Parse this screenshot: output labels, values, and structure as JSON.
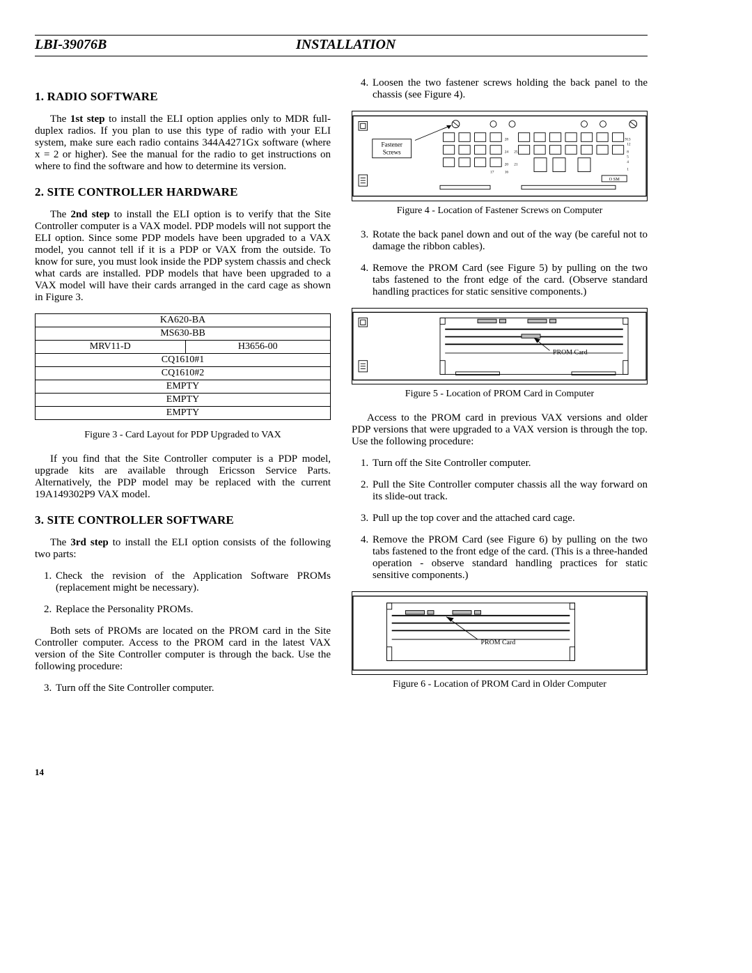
{
  "header": {
    "doc_id": "LBI-39076B",
    "title": "INSTALLATION"
  },
  "left": {
    "h1": "1. RADIO SOFTWARE",
    "p1a": "The ",
    "p1b": "1st step",
    "p1c": " to install the ELI option applies only to MDR full-duplex radios.  If you plan to use this type of radio with your ELI system, make sure each radio contains 344A4271Gx software (where x = 2 or higher).  See the manual for the radio to get instructions on where to find the software and how to determine its version.",
    "h2": "2. SITE CONTROLLER HARDWARE",
    "p2a": "The ",
    "p2b": "2nd step",
    "p2c": " to install the ELI option is to verify that the Site Controller computer is a VAX model.  PDP models will not support the ELI option.  Since some PDP models have been upgraded to a VAX model, you cannot tell if it is a PDP or VAX from the outside.  To know for sure, you must look inside the PDP system chassis and check what cards are installed. PDP models that have been upgraded to a VAX model will have their cards arranged in the card cage as shown in Figure 3.",
    "table": {
      "r1": "KA620-BA",
      "r2": "MS630-BB",
      "r3a": "MRV11-D",
      "r3b": "H3656-00",
      "r4": "CQ1610#1",
      "r5": "CQ1610#2",
      "r6": "EMPTY",
      "r7": "EMPTY",
      "r8": "EMPTY"
    },
    "fig3cap": "Figure 3 - Card Layout for PDP Upgraded to VAX",
    "p3": "If you find that the Site Controller computer is a PDP model, upgrade kits are available through Ericsson Service Parts.  Alternatively, the PDP model may be replaced with the current 19A149302P9 VAX model.",
    "h3": "3. SITE CONTROLLER SOFTWARE",
    "p4a": "The ",
    "p4b": "3rd step",
    "p4c": " to install the ELI option consists of the following two parts:",
    "li1": "Check the revision of the Application Software PROMs (replacement might be necessary).",
    "li2": "Replace the Personality PROMs.",
    "p5": "Both sets of PROMs are located on the PROM card in the Site Controller computer.  Access to the PROM card in the latest VAX version of the Site Controller computer is through the back. Use the following procedure:",
    "li3": "Turn off the Site Controller computer."
  },
  "right": {
    "li4": "Loosen the two fastener screws holding the back panel to the chassis (see Figure 4).",
    "fig4": {
      "label1": "Fastener",
      "label2": "Screws",
      "nums": {
        "n28": "28",
        "n25": "25",
        "n24": "24",
        "n21": "21",
        "n20": "20",
        "n17": "17",
        "n16": "16",
        "n13": "13",
        "n12": "12",
        "n9": "9",
        "n8": "8",
        "n5": "5",
        "n4": "4",
        "n1": "1"
      },
      "osm": "O SM"
    },
    "fig4cap": "Figure 4 - Location of Fastener Screws on Computer",
    "li5": "Rotate the back panel down and out of the way (be careful not to damage the ribbon cables).",
    "li6": "Remove the PROM Card (see Figure 5) by pulling on the two tabs fastened to the front edge of the card.  (Observe standard handling practices for static sensitive components.)",
    "fig5label": "PROM Card",
    "fig5cap": "Figure 5 - Location of PROM Card in Computer",
    "p6": "Access to the PROM card in previous VAX versions and older PDP versions that were upgraded to a VAX version is through the top.  Use the following procedure:",
    "li7": "Turn off the Site Controller computer.",
    "li8": "Pull the Site Controller computer chassis all the way forward on its slide-out track.",
    "li9": "Pull up the top cover and the attached card cage.",
    "li10": "Remove the PROM Card (see Figure 6) by pulling on the two tabs fastened to the front edge of the card.  (This is a three-handed operation - observe standard handling practices for static sensitive components.)",
    "fig6label": "PROM Card",
    "fig6cap": "Figure 6 - Location of PROM Card in Older Computer"
  },
  "page_num": "14"
}
